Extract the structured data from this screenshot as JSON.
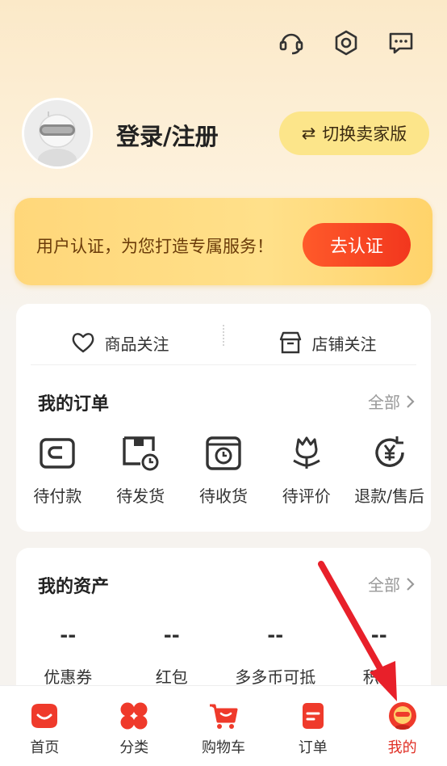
{
  "header": {
    "login_text": "登录/注册",
    "switch_label": "切换卖家版",
    "switch_icon": "⇄"
  },
  "verify": {
    "text": "用户认证，为您打造专属服务！",
    "button": "去认证"
  },
  "follow": {
    "goods": "商品关注",
    "shop": "店铺关注"
  },
  "orders": {
    "title": "我的订单",
    "more": "全部",
    "items": [
      {
        "label": "待付款",
        "icon": "wallet-icon"
      },
      {
        "label": "待发货",
        "icon": "shipping-box-icon"
      },
      {
        "label": "待收货",
        "icon": "delivery-box-icon"
      },
      {
        "label": "待评价",
        "icon": "flower-icon"
      },
      {
        "label": "退款/售后",
        "icon": "refund-icon"
      }
    ]
  },
  "assets": {
    "title": "我的资产",
    "more": "全部",
    "items": [
      {
        "value": "--",
        "label": "优惠券"
      },
      {
        "value": "--",
        "label": "红包"
      },
      {
        "value": "--",
        "label": "多多币可抵"
      },
      {
        "value": "--",
        "label": "积分"
      }
    ]
  },
  "tabbar": {
    "items": [
      {
        "label": "首页",
        "icon": "home-icon"
      },
      {
        "label": "分类",
        "icon": "category-icon"
      },
      {
        "label": "购物车",
        "icon": "cart-icon"
      },
      {
        "label": "订单",
        "icon": "order-icon"
      },
      {
        "label": "我的",
        "icon": "profile-icon",
        "active": true
      }
    ]
  },
  "colors": {
    "accent": "#e02e24",
    "verify_button": "#f2371e",
    "switch_button": "#fce58a"
  }
}
